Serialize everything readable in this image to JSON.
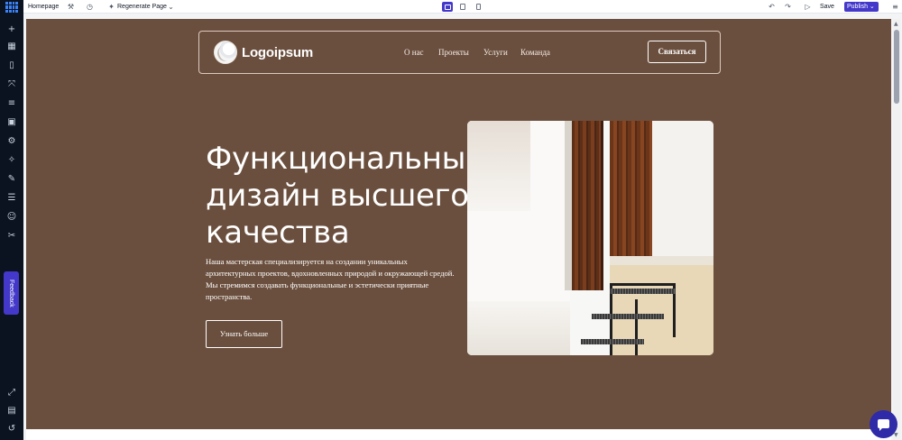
{
  "editor": {
    "page_name": "Homepage",
    "regenerate_label": "Regenerate Page",
    "save_label": "Save",
    "publish_label": "Publish",
    "feedback_label": "Feedback",
    "active_device": "desktop",
    "accent_color": "#4338ca"
  },
  "site": {
    "logo_text": "Logoipsum",
    "nav": [
      "О нас",
      "Проекты",
      "Услуги",
      "Команда"
    ],
    "cta_label": "Связаться",
    "hero_title": "Функциональный дизайн высшего качества",
    "hero_text": "Наша мастерская специализируется на создании уникальных архитектурных проектов, вдохновленных природой и окружающей средой. Мы стремимся создавать функциональные и эстетически приятные пространства.",
    "hero_button": "Узнать больше",
    "background_color": "#6b4f3e"
  }
}
